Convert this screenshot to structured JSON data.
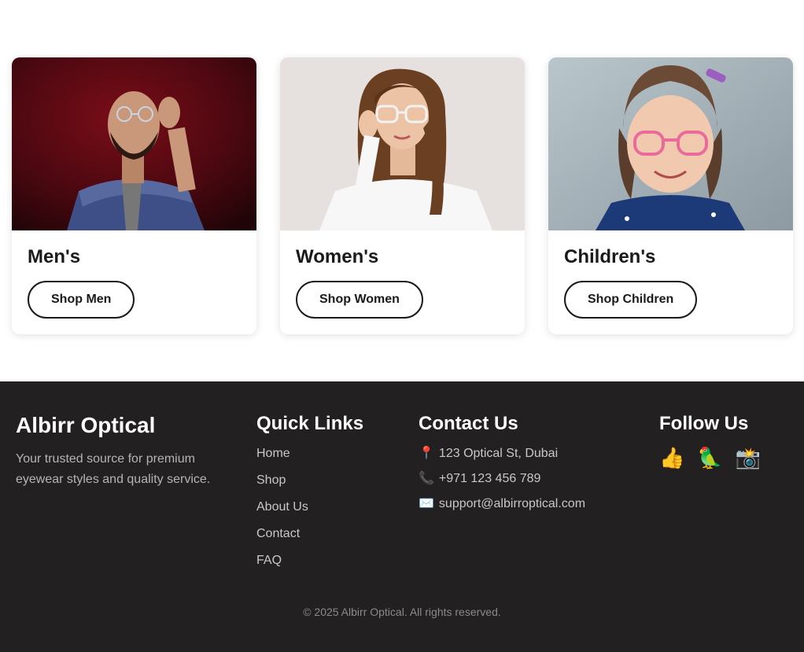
{
  "categories": [
    {
      "title": "Men's",
      "button": "Shop Men",
      "image": "man-with-glasses"
    },
    {
      "title": "Women's",
      "button": "Shop Women",
      "image": "woman-with-glasses"
    },
    {
      "title": "Children's",
      "button": "Shop Children",
      "image": "girl-with-glasses"
    }
  ],
  "footer": {
    "brand": {
      "name": "Albirr Optical",
      "description": "Your trusted source for premium eyewear styles and quality service."
    },
    "quick_links": {
      "heading": "Quick Links",
      "items": [
        "Home",
        "Shop",
        "About Us",
        "Contact",
        "FAQ"
      ]
    },
    "contact": {
      "heading": "Contact Us",
      "items": [
        {
          "icon": "📍",
          "icon_name": "pin-icon",
          "text": "123 Optical St, Dubai"
        },
        {
          "icon": "📞",
          "icon_name": "phone-icon",
          "text": "+971 123 456 789"
        },
        {
          "icon": "✉️",
          "icon_name": "envelope-icon",
          "text": "support@albirroptical.com"
        }
      ]
    },
    "follow": {
      "heading": "Follow Us",
      "icons": [
        {
          "glyph": "👍",
          "name": "facebook-like-icon"
        },
        {
          "glyph": "🦜",
          "name": "bird-icon"
        },
        {
          "glyph": "📸",
          "name": "camera-icon"
        }
      ]
    },
    "copyright": "© 2025 Albirr Optical. All rights reserved."
  },
  "colors": {
    "footer_bg": "#222021",
    "text_dark": "#1a1a1a",
    "men_bg": "#5a0a12",
    "women_bg": "#e6e1de",
    "children_bg": "#a8b6bd"
  }
}
